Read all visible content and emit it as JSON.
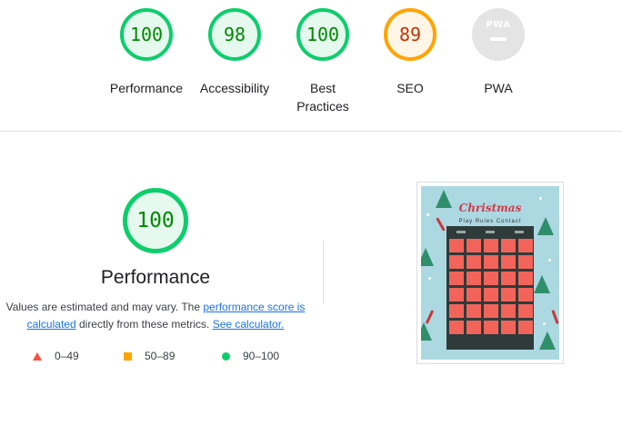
{
  "scores": [
    {
      "id": "performance",
      "value": "100",
      "label": "Performance",
      "rating": "pass"
    },
    {
      "id": "accessibility",
      "value": "98",
      "label": "Accessibility",
      "rating": "pass"
    },
    {
      "id": "best-practices",
      "value": "100",
      "label_line1": "Best",
      "label_line2": "Practices",
      "rating": "pass"
    },
    {
      "id": "seo",
      "value": "89",
      "label": "SEO",
      "rating": "average"
    },
    {
      "id": "pwa",
      "value": "PWA",
      "label": "PWA",
      "rating": "na"
    }
  ],
  "performance_section": {
    "score": "100",
    "title": "Performance",
    "desc_prefix": "Values are estimated and may vary. The ",
    "score_link": "performance score is calculated",
    "desc_middle": " directly from these metrics. ",
    "calculator_link": "See calculator."
  },
  "legend": {
    "fail": "0–49",
    "average": "50–89",
    "pass": "90–100"
  },
  "screenshot": {
    "title": "Christmas",
    "menu": "Play  Rules  Contact"
  },
  "colors": {
    "pass": "#0cce6b",
    "average": "#ffa400",
    "fail": "#ff4e42",
    "link": "#1a73e8"
  }
}
